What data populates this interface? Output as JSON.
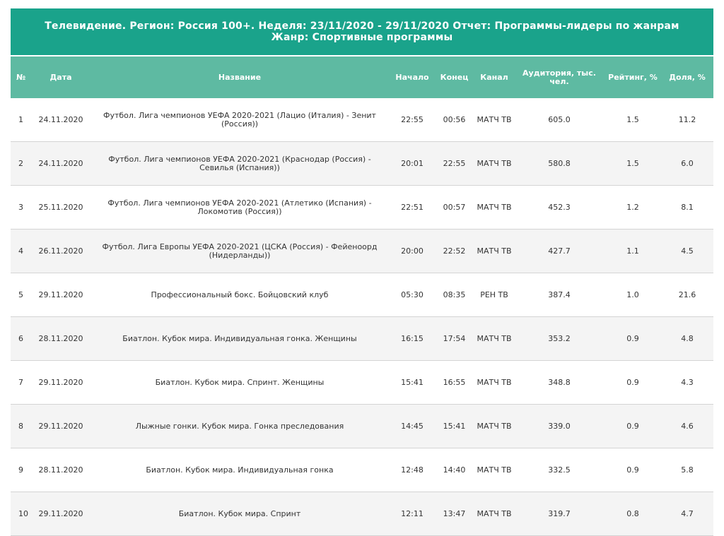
{
  "report": {
    "title": "Телевидение. Регион: Россия 100+. Неделя: 23/11/2020 - 29/11/2020 Отчет: Программы-лидеры по жанрам Жанр: Спортивные программы"
  },
  "columns": {
    "num": "№",
    "date": "Дата",
    "name": "Название",
    "start": "Начало",
    "end": "Конец",
    "channel": "Канал",
    "audience": "Аудитория, тыс. чел.",
    "rating": "Рейтинг, %",
    "share": "Доля, %"
  },
  "rows": [
    {
      "num": "1",
      "date": "24.11.2020",
      "name": "Футбол. Лига чемпионов УЕФА 2020-2021 (Лацио (Италия) - Зенит (Россия))",
      "start": "22:55",
      "end": "00:56",
      "channel": "МАТЧ ТВ",
      "audience": "605.0",
      "rating": "1.5",
      "share": "11.2"
    },
    {
      "num": "2",
      "date": "24.11.2020",
      "name": "Футбол. Лига чемпионов УЕФА 2020-2021 (Краснодар (Россия) - Севилья (Испания))",
      "start": "20:01",
      "end": "22:55",
      "channel": "МАТЧ ТВ",
      "audience": "580.8",
      "rating": "1.5",
      "share": "6.0"
    },
    {
      "num": "3",
      "date": "25.11.2020",
      "name": "Футбол. Лига чемпионов УЕФА 2020-2021 (Атлетико (Испания) - Локомотив (Россия))",
      "start": "22:51",
      "end": "00:57",
      "channel": "МАТЧ ТВ",
      "audience": "452.3",
      "rating": "1.2",
      "share": "8.1"
    },
    {
      "num": "4",
      "date": "26.11.2020",
      "name": "Футбол. Лига Европы УЕФА 2020-2021 (ЦСКА (Россия) - Фейеноорд (Нидерланды))",
      "start": "20:00",
      "end": "22:52",
      "channel": "МАТЧ ТВ",
      "audience": "427.7",
      "rating": "1.1",
      "share": "4.5"
    },
    {
      "num": "5",
      "date": "29.11.2020",
      "name": "Профессиональный бокс. Бойцовский клуб",
      "start": "05:30",
      "end": "08:35",
      "channel": "РЕН ТВ",
      "audience": "387.4",
      "rating": "1.0",
      "share": "21.6"
    },
    {
      "num": "6",
      "date": "28.11.2020",
      "name": "Биатлон. Кубок мира. Индивидуальная гонка. Женщины",
      "start": "16:15",
      "end": "17:54",
      "channel": "МАТЧ ТВ",
      "audience": "353.2",
      "rating": "0.9",
      "share": "4.8"
    },
    {
      "num": "7",
      "date": "29.11.2020",
      "name": "Биатлон. Кубок мира. Спринт. Женщины",
      "start": "15:41",
      "end": "16:55",
      "channel": "МАТЧ ТВ",
      "audience": "348.8",
      "rating": "0.9",
      "share": "4.3"
    },
    {
      "num": "8",
      "date": "29.11.2020",
      "name": "Лыжные гонки. Кубок мира. Гонка преследования",
      "start": "14:45",
      "end": "15:41",
      "channel": "МАТЧ ТВ",
      "audience": "339.0",
      "rating": "0.9",
      "share": "4.6"
    },
    {
      "num": "9",
      "date": "28.11.2020",
      "name": "Биатлон. Кубок мира. Индивидуальная гонка",
      "start": "12:48",
      "end": "14:40",
      "channel": "МАТЧ ТВ",
      "audience": "332.5",
      "rating": "0.9",
      "share": "5.8"
    },
    {
      "num": "10",
      "date": "29.11.2020",
      "name": "Биатлон. Кубок мира. Спринт",
      "start": "12:11",
      "end": "13:47",
      "channel": "МАТЧ ТВ",
      "audience": "319.7",
      "rating": "0.8",
      "share": "4.7"
    }
  ]
}
